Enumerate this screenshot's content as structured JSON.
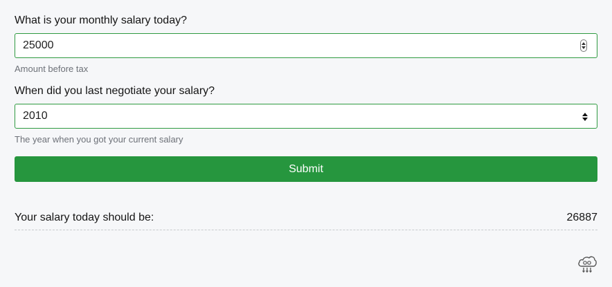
{
  "salary_question": {
    "label": "What is your monthly salary today?",
    "value": "25000",
    "hint": "Amount before tax"
  },
  "negotiation_question": {
    "label": "When did you last negotiate your salary?",
    "selected": "2010",
    "hint": "The year when you got your current salary"
  },
  "submit": {
    "label": "Submit"
  },
  "result": {
    "label": "Your salary today should be:",
    "value": "26887"
  },
  "colors": {
    "accent": "#26963e",
    "field_border": "#2e9a40",
    "background": "#f6f7f9"
  },
  "icons": {
    "footer": "cloud-go-icon"
  }
}
